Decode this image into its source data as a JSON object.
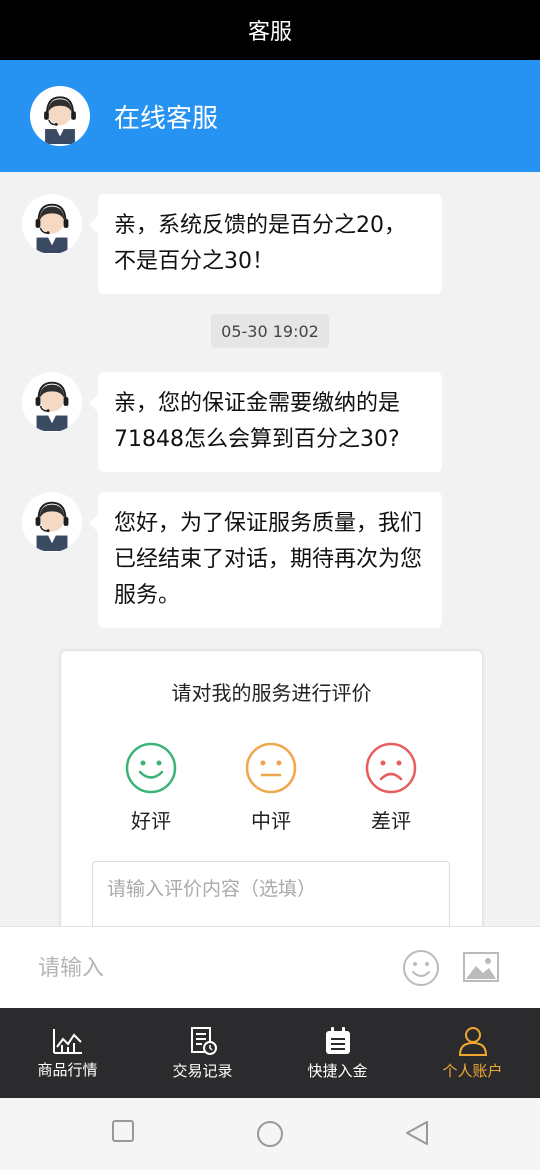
{
  "status_bar": {
    "title": "客服"
  },
  "header": {
    "title": "在线客服",
    "avatar_icon": "agent-avatar-icon"
  },
  "messages": [
    {
      "text": "亲，系统反馈的是百分之20，不是百分之30！"
    },
    {
      "text": "亲，您的保证金需要缴纳的是71848怎么会算到百分之30?"
    },
    {
      "text": "您好，为了保证服务质量，我们已经结束了对话，期待再次为您服务。"
    }
  ],
  "timestamp": "05-30 19:02",
  "rating": {
    "prompt": "请对我的服务进行评价",
    "options": [
      {
        "label": "好评",
        "color": "#3db37a",
        "icon": "smile-icon"
      },
      {
        "label": "中评",
        "color": "#f0a64a",
        "icon": "neutral-face-icon"
      },
      {
        "label": "差评",
        "color": "#e85d5d",
        "icon": "frown-icon"
      }
    ],
    "comment_placeholder": "请输入评价内容（选填）"
  },
  "input": {
    "placeholder": "请输入",
    "emoji_icon": "emoji-icon",
    "image_icon": "image-icon"
  },
  "tabs": [
    {
      "label": "商品行情",
      "icon": "chart-icon"
    },
    {
      "label": "交易记录",
      "icon": "record-icon"
    },
    {
      "label": "快捷入金",
      "icon": "deposit-icon"
    },
    {
      "label": "个人账户",
      "icon": "user-icon",
      "active": true
    }
  ],
  "colors": {
    "header": "#2693f2",
    "tab_bar": "#2b2b2d",
    "active_tab": "#f0a833"
  }
}
